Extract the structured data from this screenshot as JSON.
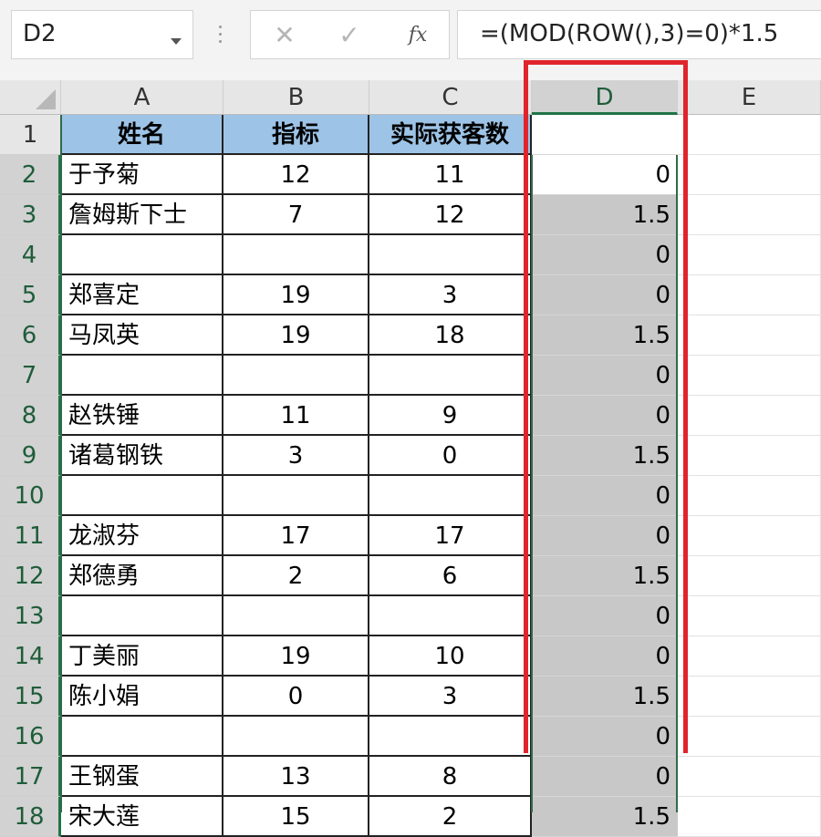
{
  "formula_bar": {
    "name_box": "D2",
    "cancel_icon": "✕",
    "enter_icon": "✓",
    "fx_label": "fx",
    "formula": "=(MOD(ROW(),3)=0)*1.5"
  },
  "columns": [
    "A",
    "B",
    "C",
    "D",
    "E"
  ],
  "selected_column": "D",
  "header_row": {
    "row": "1",
    "a": "姓名",
    "b": "指标",
    "c": "实际获客数",
    "d": ""
  },
  "rows": [
    {
      "row": "2",
      "a": "于予菊",
      "b": "12",
      "c": "11",
      "d": "0"
    },
    {
      "row": "3",
      "a": "詹姆斯下士",
      "b": "7",
      "c": "12",
      "d": "1.5"
    },
    {
      "row": "4",
      "a": "",
      "b": "",
      "c": "",
      "d": "0"
    },
    {
      "row": "5",
      "a": "郑喜定",
      "b": "19",
      "c": "3",
      "d": "0"
    },
    {
      "row": "6",
      "a": "马凤英",
      "b": "19",
      "c": "18",
      "d": "1.5"
    },
    {
      "row": "7",
      "a": "",
      "b": "",
      "c": "",
      "d": "0"
    },
    {
      "row": "8",
      "a": "赵铁锤",
      "b": "11",
      "c": "9",
      "d": "0"
    },
    {
      "row": "9",
      "a": "诸葛钢铁",
      "b": "3",
      "c": "0",
      "d": "1.5"
    },
    {
      "row": "10",
      "a": "",
      "b": "",
      "c": "",
      "d": "0"
    },
    {
      "row": "11",
      "a": "龙淑芬",
      "b": "17",
      "c": "17",
      "d": "0"
    },
    {
      "row": "12",
      "a": "郑德勇",
      "b": "2",
      "c": "6",
      "d": "1.5"
    },
    {
      "row": "13",
      "a": "",
      "b": "",
      "c": "",
      "d": "0"
    },
    {
      "row": "14",
      "a": "丁美丽",
      "b": "19",
      "c": "10",
      "d": "0"
    },
    {
      "row": "15",
      "a": "陈小娟",
      "b": "0",
      "c": "3",
      "d": "1.5"
    },
    {
      "row": "16",
      "a": "",
      "b": "",
      "c": "",
      "d": "0"
    },
    {
      "row": "17",
      "a": "王钢蛋",
      "b": "13",
      "c": "8",
      "d": "0"
    },
    {
      "row": "18",
      "a": "宋大莲",
      "b": "15",
      "c": "2",
      "d": "1.5"
    }
  ],
  "colors": {
    "header_fill": "#9dc3e6",
    "selection_fill": "#c8c8c8",
    "annotation_red": "#e0242c",
    "excel_green": "#217346"
  }
}
